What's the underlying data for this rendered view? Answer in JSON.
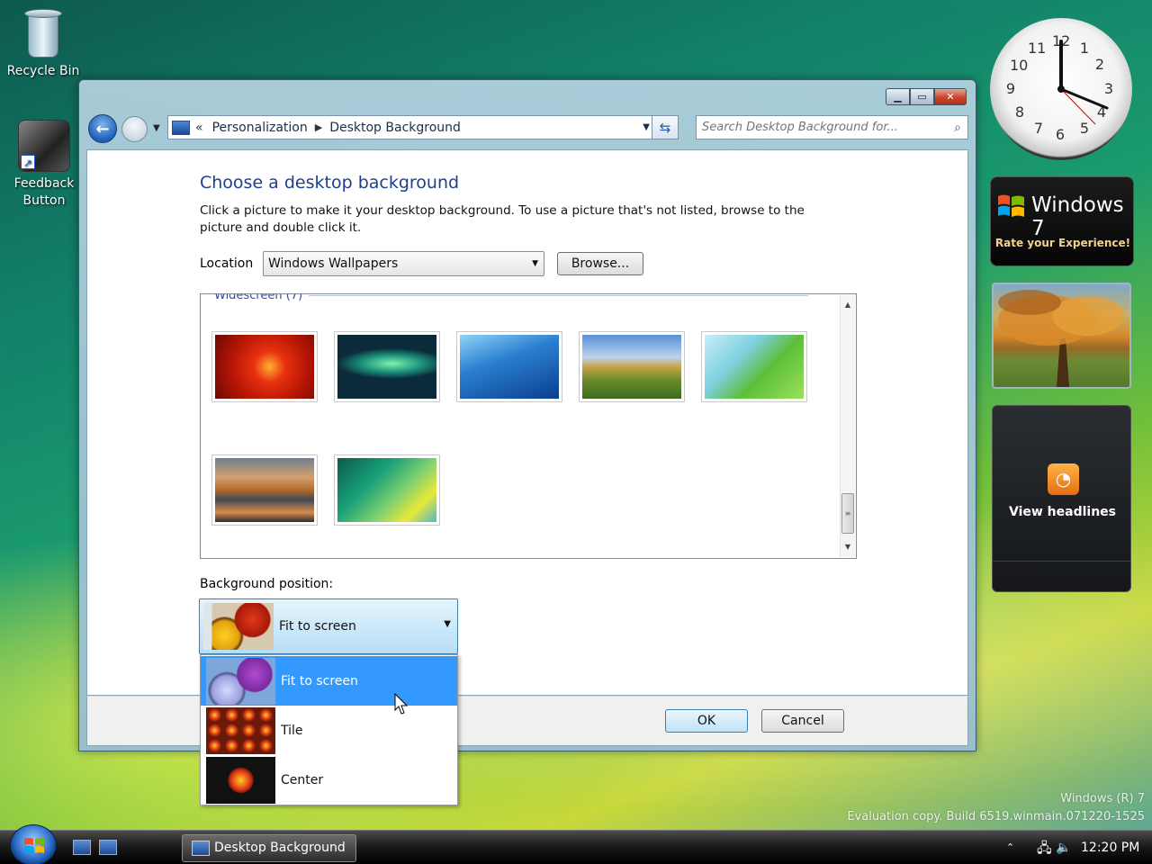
{
  "desktop": {
    "icons": [
      {
        "label": "Recycle Bin"
      },
      {
        "label": "Feedback Button"
      }
    ],
    "watermark_line1": "Windows (R) 7",
    "watermark_line2": "Evaluation copy. Build 6519.winmain.071220-1525"
  },
  "window": {
    "breadcrumb": {
      "prefix": "«",
      "items": [
        "Personalization",
        "Desktop Background"
      ]
    },
    "search_placeholder": "Search Desktop Background for...",
    "heading": "Choose a desktop background",
    "description": "Click a picture to make it your desktop background. To use a picture that's not listed, browse to the picture and double click it.",
    "location_label": "Location",
    "location_value": "Windows Wallpapers",
    "browse_label": "Browse...",
    "group_title": "Widescreen (7)",
    "group_collapse": "⌃",
    "thumbnails": [
      {
        "name": "red-flower"
      },
      {
        "name": "aurora"
      },
      {
        "name": "fish"
      },
      {
        "name": "landscape"
      },
      {
        "name": "palm-leaf"
      },
      {
        "name": "rocks-lake"
      },
      {
        "name": "vista-aurora"
      }
    ],
    "bg_position_label": "Background position:",
    "bg_position_selected": "Fit to screen",
    "bg_position_options": [
      "Fit to screen",
      "Tile",
      "Center"
    ],
    "ok_label": "OK",
    "cancel_label": "Cancel"
  },
  "gadgets": {
    "clock": {
      "numbers": [
        "12",
        "1",
        "2",
        "3",
        "4",
        "5",
        "6",
        "7",
        "8",
        "9",
        "10",
        "11"
      ],
      "time": "12:20"
    },
    "windows7": {
      "title": "Windows 7",
      "subtitle": "Rate your Experience!"
    },
    "rss": {
      "label": "View headlines"
    }
  },
  "taskbar": {
    "task_label": "Desktop Background",
    "clock": "12:20 PM"
  },
  "colors": {
    "accent_blue": "#1e3f8a",
    "selection": "#3399ff"
  }
}
